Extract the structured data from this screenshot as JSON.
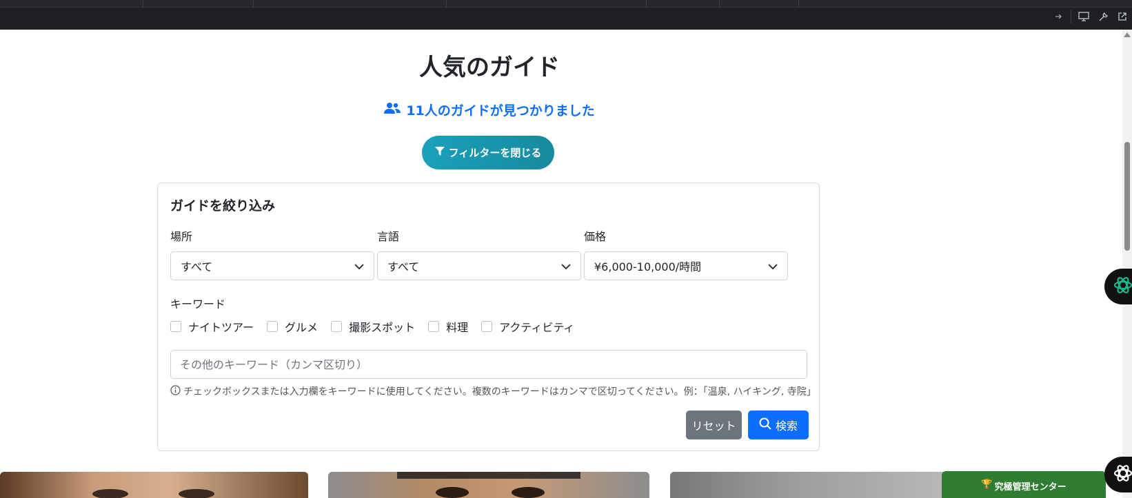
{
  "page": {
    "title": "人気のガイド",
    "found_text": "11人のガイドが見つかりました",
    "filter_toggle_label": "フィルターを閉じる"
  },
  "filter": {
    "heading": "ガイドを絞り込み",
    "location": {
      "label": "場所",
      "value": "すべて"
    },
    "language": {
      "label": "言語",
      "value": "すべて"
    },
    "price": {
      "label": "価格",
      "value": "¥6,000-10,000/時間"
    },
    "keyword_label": "キーワード",
    "keywords": [
      "ナイトツアー",
      "グルメ",
      "撮影スポット",
      "料理",
      "アクティビティ"
    ],
    "keyword_input_placeholder": "その他のキーワード（カンマ区切り）",
    "help_text": "チェックボックスまたは入力欄をキーワードに使用してください。複数のキーワードはカンマで区切ってください。例：「温泉, ハイキング, 寺院」",
    "reset_label": "リセット",
    "search_label": "検索"
  },
  "admin_badge": "究極管理センター",
  "colors": {
    "primary": "#0d6efd",
    "info": "#17a2b8",
    "secondary": "#6c757d",
    "admin_green": "#2e7d32",
    "topbar": "#1e2026"
  }
}
